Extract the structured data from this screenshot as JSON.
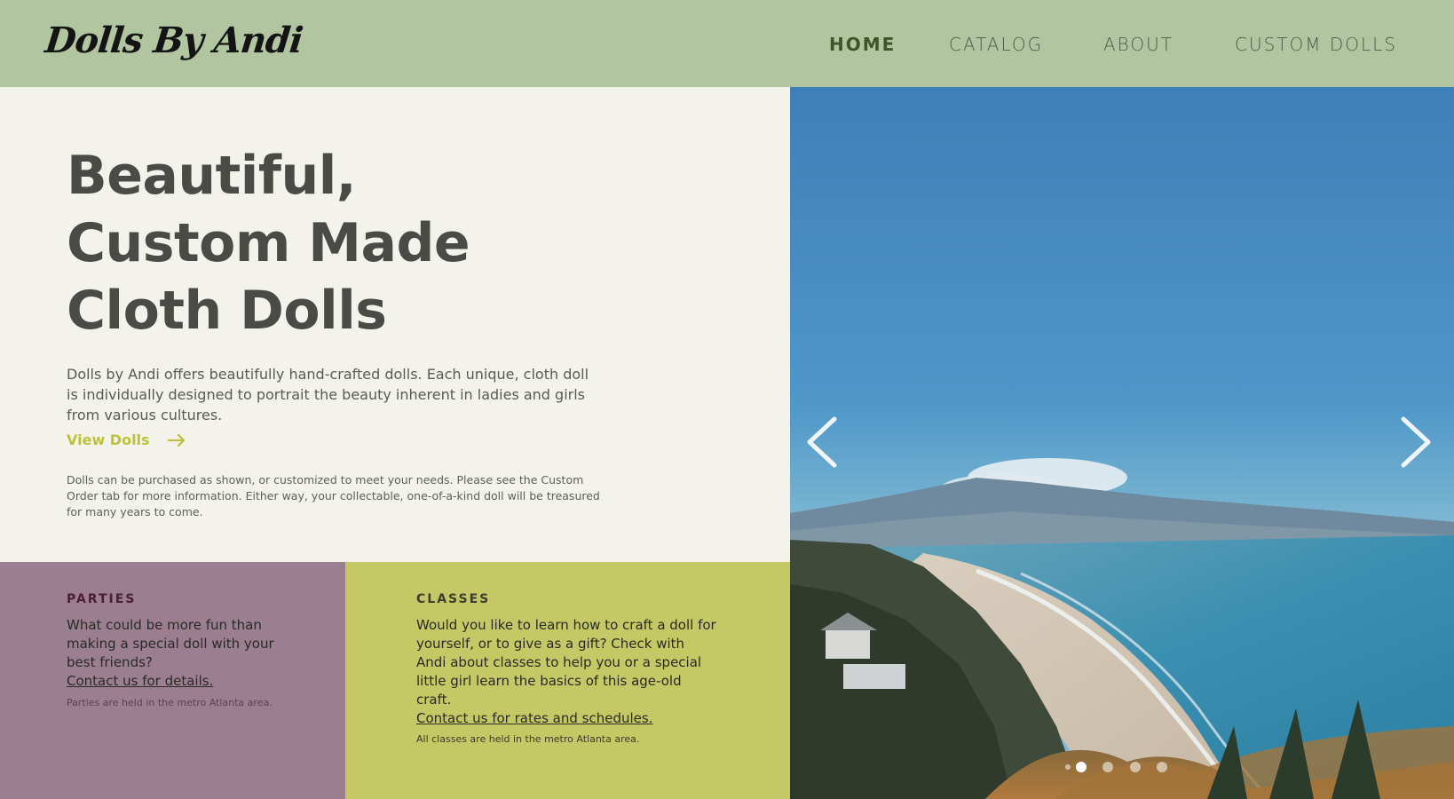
{
  "brand": {
    "logo_text": "Dolls By Andi"
  },
  "nav": {
    "items": [
      {
        "label": "HOME",
        "active": true
      },
      {
        "label": "CATALOG",
        "active": false
      },
      {
        "label": "ABOUT",
        "active": false
      },
      {
        "label": "CUSTOM DOLLS",
        "active": false
      }
    ]
  },
  "hero": {
    "title_lines": [
      "Beautiful,",
      "Custom Made",
      "Cloth Dolls"
    ],
    "description": "Dolls by Andi offers beautifully hand-crafted dolls.  Each unique, cloth doll is individually designed to portrait the beauty inherent in ladies and girls from various cultures.",
    "cta_label": "View Dolls",
    "note": "Dolls can be purchased as shown, or customized to meet your needs.  Please see the Custom Order tab for more information.  Either way, your collectable, one-of-a-kind doll will be treasured for many years to come."
  },
  "parties": {
    "heading": "PARTIES",
    "body": "What could be more fun than making a special doll with your best friends?",
    "link": "Contact us for details.",
    "note": "Parties are held in the metro Atlanta area."
  },
  "classes": {
    "heading": "CLASSES",
    "body": "Would you like to learn how to craft a doll for yourself, or to give as a gift?  Check with Andi about classes to help you or a special little girl learn the basics of this age-old craft.",
    "link": "Contact us for rates and schedules.",
    "note": "All classes are held in the metro Atlanta area."
  },
  "slider": {
    "icons": {
      "prev": "chevron-left-icon",
      "next": "chevron-right-icon"
    },
    "slide_count": 5,
    "active_index": 1
  },
  "colors": {
    "header_bg": "#b1c6a0",
    "page_bg": "#f3f3ec",
    "accent": "#bcc23b",
    "parties_bg": "#9b7e8f",
    "classes_bg": "#c4c965",
    "nav_active": "#3d5628"
  }
}
